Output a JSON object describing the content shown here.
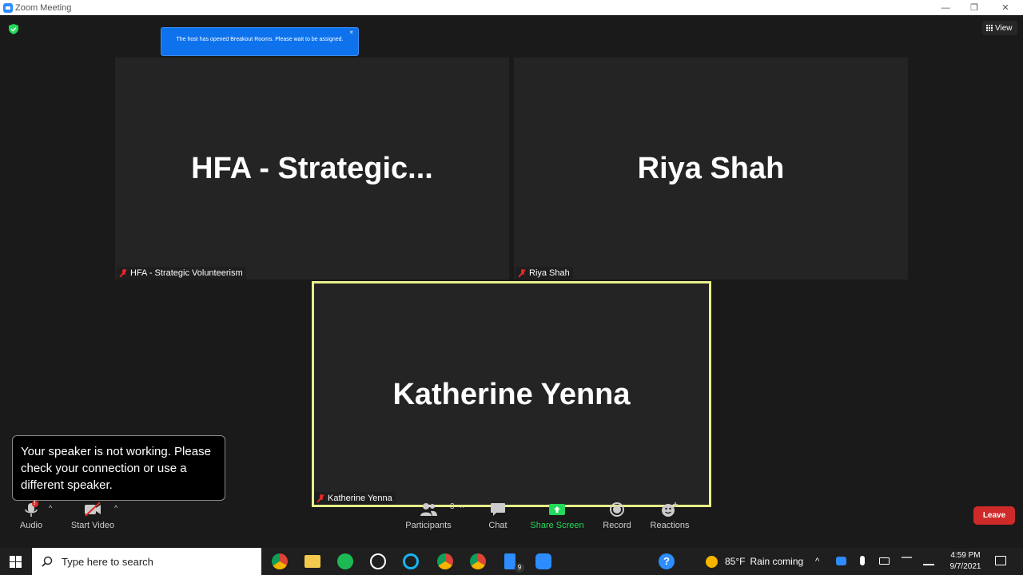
{
  "window": {
    "title": "Zoom Meeting",
    "minimize": "—",
    "restore": "❐",
    "close": "✕"
  },
  "notice": {
    "text": "The host has opened Breakout Rooms. Please wait to be assigned.",
    "close": "×"
  },
  "view_button": {
    "label": "View"
  },
  "tiles": [
    {
      "display_name": "HFA  -  Strategic...",
      "tag": "HFA - Strategic Volunteerism"
    },
    {
      "display_name": "Riya Shah",
      "tag": "Riya Shah"
    },
    {
      "display_name": "Katherine Yenna",
      "tag": "Katherine Yenna"
    }
  ],
  "speaker_warning": "Your speaker is not working. Please check your connection or use a different speaker.",
  "controls": {
    "audio": "Audio",
    "audio_badge": "!",
    "start_video": "Start Video",
    "participants": "Participants",
    "participants_count": "3",
    "chat": "Chat",
    "share_screen": "Share Screen",
    "record": "Record",
    "reactions": "Reactions",
    "leave": "Leave",
    "caret": "^"
  },
  "colors": {
    "accent": "#0e72ed",
    "share_green": "#23d959",
    "leave_red": "#cf2a2a",
    "active_border": "#e8f08a"
  },
  "taskbar": {
    "search_placeholder": "Type here to search",
    "weather_temp": "85°F",
    "weather_text": "Rain coming",
    "time": "4:59 PM",
    "date": "9/7/2021",
    "badge_count": "9"
  }
}
